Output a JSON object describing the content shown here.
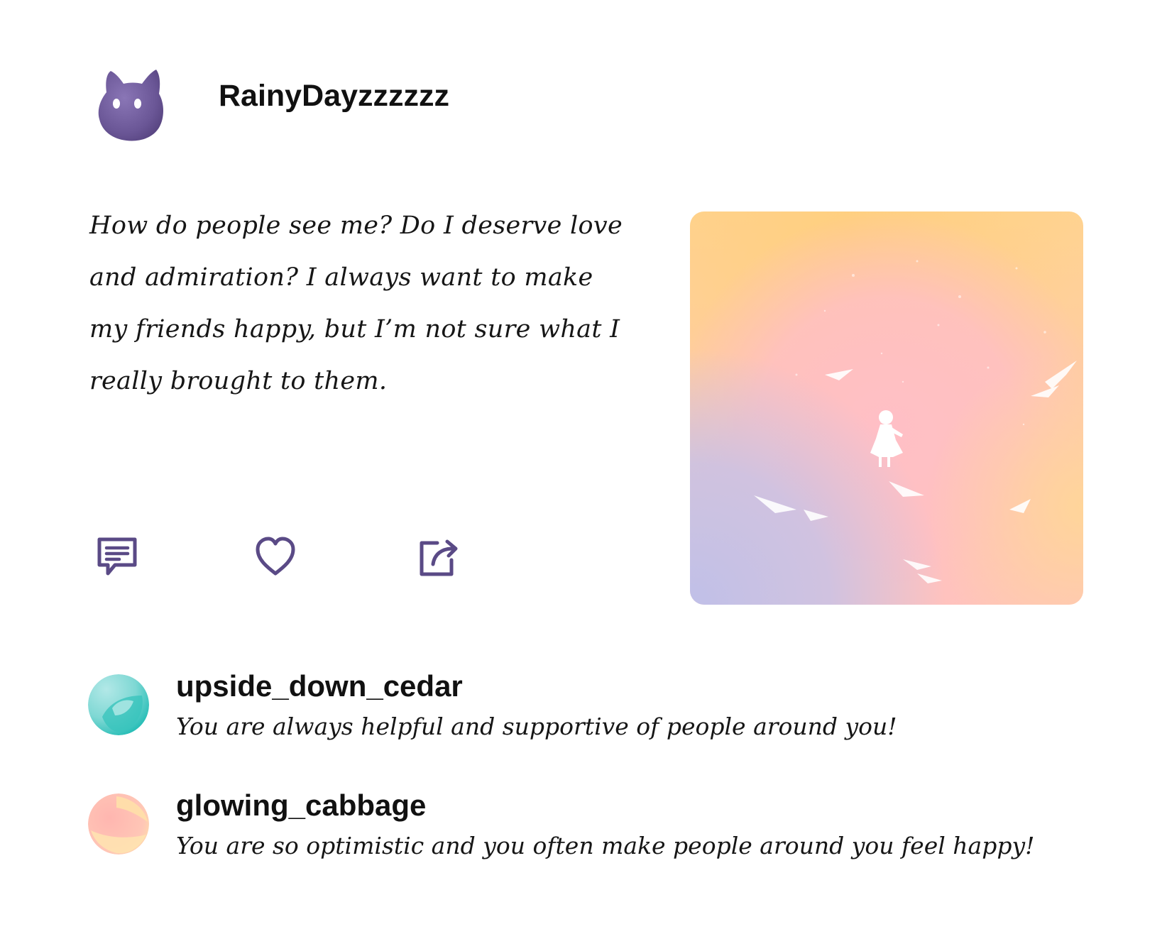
{
  "post": {
    "author": {
      "name": "RainyDayzzzzzz",
      "avatar_icon": "purple-cat-avatar",
      "avatar_color": "#6e5a9b"
    },
    "body": "How do people see me? Do I deserve love and admiration? I always want to make my friends happy, but I’m not sure what I really brought to them.",
    "image": {
      "icon": "girl-in-pastel-sky-illustration",
      "gradient_colors": [
        "#ffd48a",
        "#ffc1c3",
        "#c3c0e4"
      ]
    },
    "actions": {
      "comment_icon": "comment-icon",
      "like_icon": "heart-icon",
      "share_icon": "share-icon",
      "icon_color": "#5a4a86"
    }
  },
  "comments": [
    {
      "user": "upside_down_cedar",
      "text": "You are always helpful and supportive of people around you!",
      "avatar_colors": [
        "#2bbfb8",
        "#a6e6e4"
      ]
    },
    {
      "user": "glowing_cabbage",
      "text": "You are so optimistic and you often make people around you feel happy!",
      "avatar_colors": [
        "#ffbcb4",
        "#ffe0a8"
      ]
    }
  ]
}
